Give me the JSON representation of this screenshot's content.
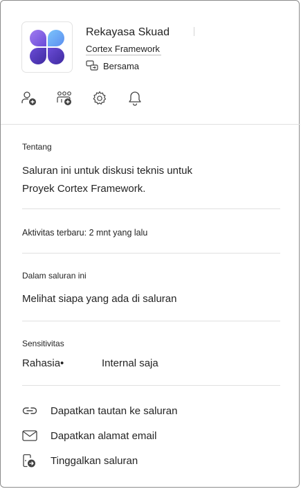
{
  "header": {
    "team_name": "Rekayasa Skuad",
    "channel_name": "Cortex Framework",
    "privacy": "Bersama"
  },
  "actions": [
    {
      "icon": "add-person-icon"
    },
    {
      "icon": "add-group-icon"
    },
    {
      "icon": "gear-icon"
    },
    {
      "icon": "bell-icon"
    }
  ],
  "about": {
    "label": "Tentang",
    "text_line1": "Saluran ini untuk diskusi teknis untuk",
    "text_line2": "Proyek Cortex Framework."
  },
  "activity": {
    "text": "Aktivitas terbaru: 2 mnt yang lalu"
  },
  "members": {
    "label": "Dalam saluran ini",
    "link": "Melihat siapa yang ada di saluran"
  },
  "sensitivity": {
    "label": "Sensitivitas",
    "value": "Rahasia•",
    "detail": "Internal saja"
  },
  "menu": [
    {
      "label": "Dapatkan tautan ke saluran",
      "icon": "link-icon"
    },
    {
      "label": "Dapatkan alamat email",
      "icon": "mail-icon"
    },
    {
      "label": "Tinggalkan saluran",
      "icon": "leave-icon"
    }
  ],
  "colors": {
    "logo_top_left": "#8e6ae8",
    "logo_top_right": "#5ea8f5",
    "logo_bottom": "#5b3fc9"
  }
}
